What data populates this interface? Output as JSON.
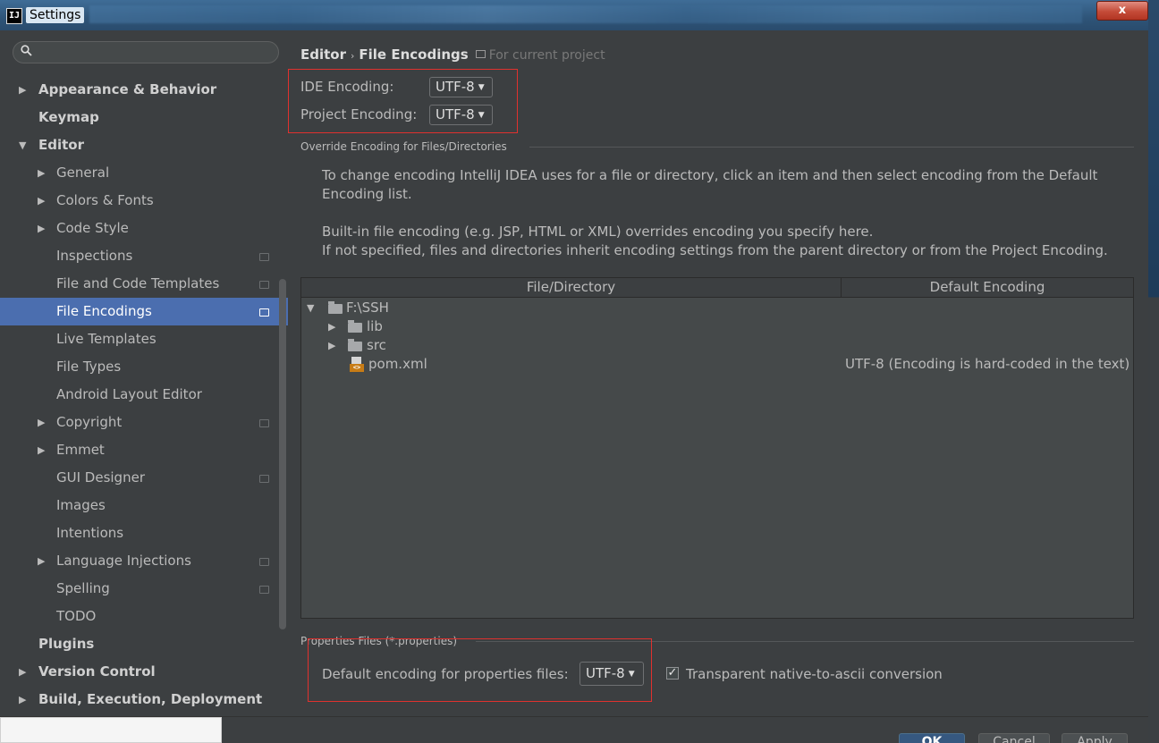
{
  "window": {
    "title": "Settings",
    "app_icon_text": "IJ",
    "close_symbol": "x"
  },
  "sidebar": {
    "search_icon": "magnifier-icon",
    "items": [
      {
        "label": "Appearance & Behavior",
        "arrow": "▶"
      },
      {
        "label": "Keymap"
      },
      {
        "label": "Editor",
        "arrow": "▼"
      },
      {
        "label": "General",
        "arrow": "▶"
      },
      {
        "label": "Colors & Fonts",
        "arrow": "▶"
      },
      {
        "label": "Code Style",
        "arrow": "▶"
      },
      {
        "label": "Inspections"
      },
      {
        "label": "File and Code Templates"
      },
      {
        "label": "File Encodings"
      },
      {
        "label": "Live Templates"
      },
      {
        "label": "File Types"
      },
      {
        "label": "Android Layout Editor"
      },
      {
        "label": "Copyright",
        "arrow": "▶"
      },
      {
        "label": "Emmet",
        "arrow": "▶"
      },
      {
        "label": "GUI Designer"
      },
      {
        "label": "Images"
      },
      {
        "label": "Intentions"
      },
      {
        "label": "Language Injections",
        "arrow": "▶"
      },
      {
        "label": "Spelling"
      },
      {
        "label": "TODO"
      },
      {
        "label": "Plugins"
      },
      {
        "label": "Version Control",
        "arrow": "▶"
      },
      {
        "label": "Build, Execution, Deployment",
        "arrow": "▶"
      }
    ]
  },
  "main": {
    "breadcrumb": {
      "parent": "Editor",
      "separator": "›",
      "current": "File Encodings",
      "scope": "For current project"
    },
    "ide_encoding": {
      "label": "IDE Encoding:",
      "value": "UTF-8",
      "caret": "▼"
    },
    "project_encoding": {
      "label": "Project Encoding:",
      "value": "UTF-8",
      "caret": "▼"
    },
    "override_group": {
      "title": "Override Encoding for Files/Directories",
      "para1_line1": "To change encoding IntelliJ IDEA uses for a file or directory, click an item and then select encoding from the Default",
      "para1_line2": "Encoding list.",
      "para2_line1": "Built-in file encoding (e.g. JSP, HTML or XML) overrides encoding you specify here.",
      "para2_line2": "If not specified, files and directories inherit encoding settings from the parent directory or from the Project Encoding."
    },
    "table": {
      "columns": [
        "File/Directory",
        "Default Encoding"
      ],
      "rows": [
        {
          "arrow": "▼",
          "name": "F:\\SSH",
          "encoding": ""
        },
        {
          "arrow": "▶",
          "name": "lib",
          "encoding": ""
        },
        {
          "arrow": "▶",
          "name": "src",
          "encoding": ""
        },
        {
          "arrow": "",
          "name": "pom.xml",
          "encoding": "UTF-8 (Encoding is hard-coded in the text)"
        }
      ]
    },
    "properties_group": {
      "title": "Properties Files (*.properties)",
      "default_label": "Default encoding for properties files:",
      "default_value": "UTF-8",
      "caret": "▼",
      "checkbox_mark": "✓",
      "native_label": "Transparent native-to-ascii conversion"
    }
  },
  "footer": {
    "ok": "OK",
    "cancel": "Cancel",
    "apply": "Apply"
  },
  "colors": {
    "selection": "#4b6eaf",
    "highlight_box": "#e0312e",
    "background": "#3c3f41"
  }
}
